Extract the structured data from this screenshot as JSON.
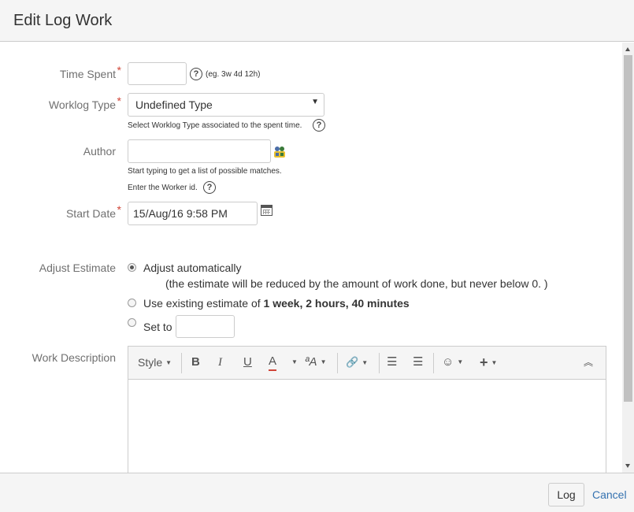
{
  "dialog": {
    "title": "Edit Log Work"
  },
  "form": {
    "time_spent": {
      "label": "Time Spent",
      "required": "*",
      "value": "",
      "hint": "(eg. 3w 4d 12h)",
      "help": "?"
    },
    "worklog_type": {
      "label": "Worklog Type",
      "required": "*",
      "selected": "Undefined Type",
      "caret": "▼",
      "hint": "Select Worklog Type associated to the spent time.",
      "help": "?"
    },
    "author": {
      "label": "Author",
      "value": "",
      "hint1": "Start typing to get a list of possible matches.",
      "hint2": "Enter the Worker id.",
      "help": "?"
    },
    "start_date": {
      "label": "Start Date",
      "required": "*",
      "value": "15/Aug/16 9:58 PM"
    },
    "adjust_estimate": {
      "label": "Adjust Estimate",
      "options": [
        {
          "label": "Adjust automatically",
          "note": "(the estimate will be reduced by the amount of work done, but never below 0. )",
          "selected": true
        },
        {
          "label": "Use existing estimate of ",
          "bold": "1 week, 2 hours, 40 minutes",
          "selected": false
        },
        {
          "label": "Set to",
          "selected": false
        }
      ]
    },
    "work_description": {
      "label": "Work Description",
      "toolbar": {
        "style": "Style",
        "bold": "B",
        "italic": "I",
        "underline": "U",
        "text_color": "A",
        "text_size": "ªA",
        "link": "🔗",
        "bullet_list": "☰",
        "numbered_list": "☰",
        "emoticon": "☺",
        "insert": "+",
        "collapse": "︽",
        "caret": "▼"
      }
    }
  },
  "footer": {
    "log_button": "Log",
    "cancel_link": "Cancel"
  },
  "colors": {
    "required": "#d04437",
    "link": "#3572b0",
    "text_color_underline": "#d04437"
  }
}
